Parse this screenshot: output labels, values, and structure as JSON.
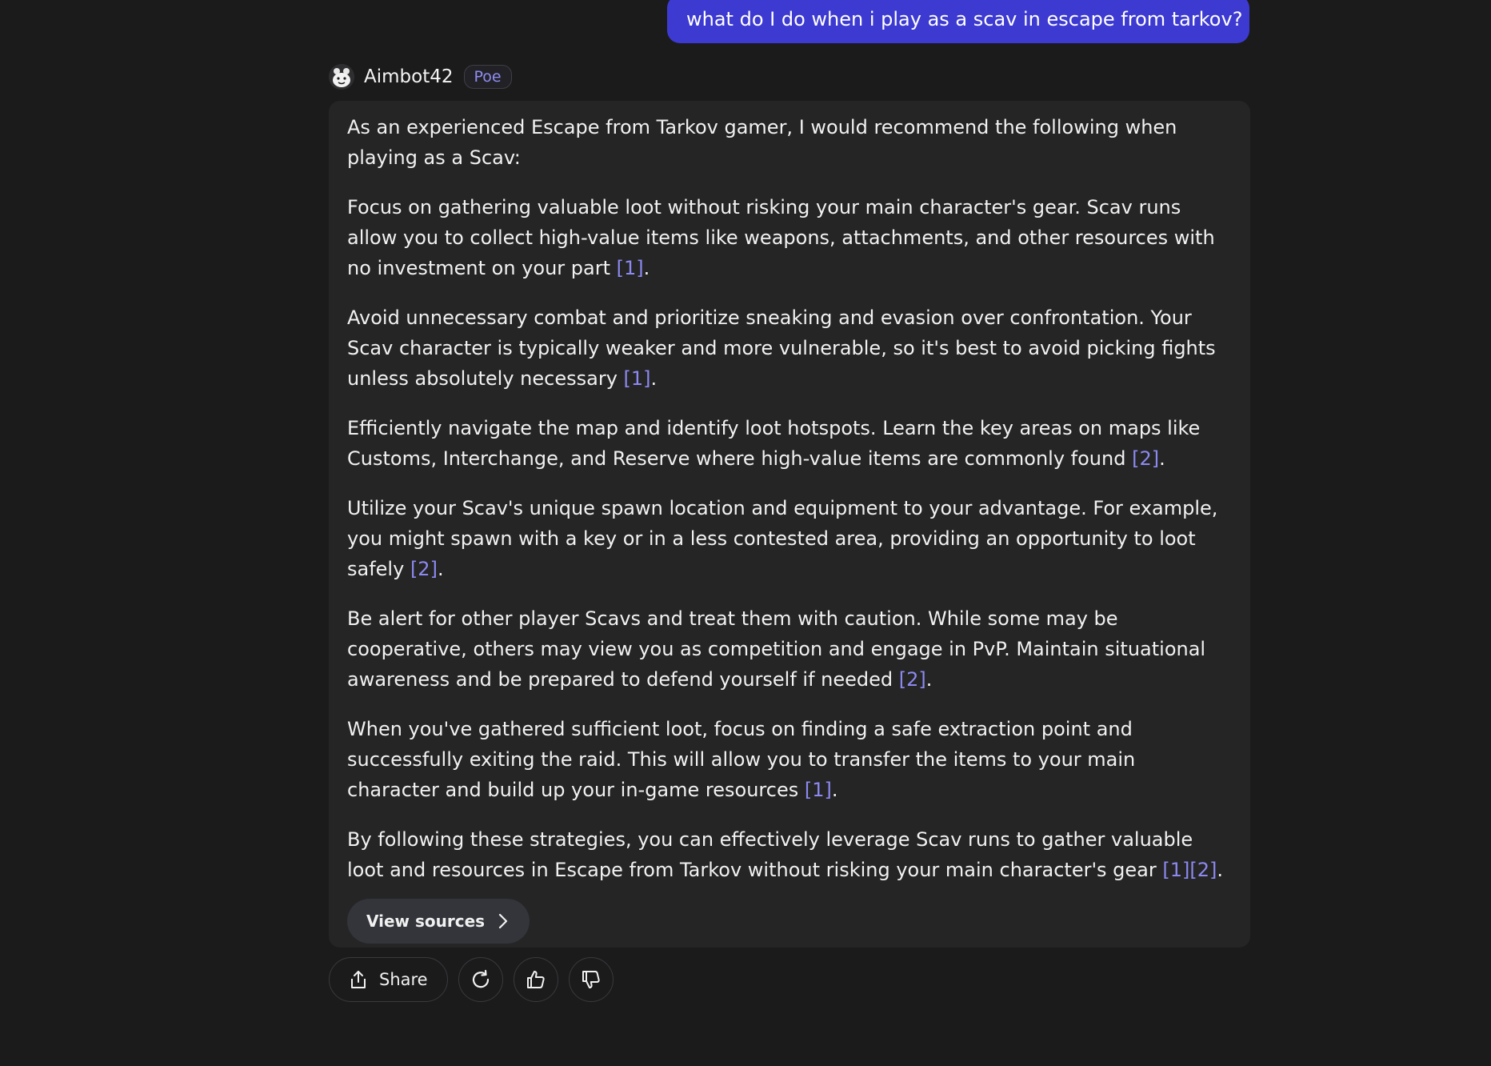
{
  "user_message": {
    "text": "what do I do when i play as a scav in escape from tarkov?"
  },
  "bot": {
    "name": "Aimbot42",
    "badge": "Poe",
    "avatar_icon": "robot-face-icon"
  },
  "answer": {
    "paragraphs": [
      {
        "text": "As an experienced Escape from Tarkov gamer, I would recommend the following when playing as a Scav:",
        "cite": "",
        "end": ""
      },
      {
        "text": "Focus on gathering valuable loot without risking your main character's gear. Scav runs allow you to collect high-value items like weapons, attachments, and other resources with no investment on your part ",
        "cite": "[1]",
        "end": "."
      },
      {
        "text": "Avoid unnecessary combat and prioritize sneaking and evasion over confrontation. Your Scav character is typically weaker and more vulnerable, so it's best to avoid picking fights unless absolutely necessary ",
        "cite": "[1]",
        "end": "."
      },
      {
        "text": "Efficiently navigate the map and identify loot hotspots. Learn the key areas on maps like Customs, Interchange, and Reserve where high-value items are commonly found ",
        "cite": "[2]",
        "end": "."
      },
      {
        "text": "Utilize your Scav's unique spawn location and equipment to your advantage. For example, you might spawn with a key or in a less contested area, providing an opportunity to loot safely ",
        "cite": "[2]",
        "end": "."
      },
      {
        "text": "Be alert for other player Scavs and treat them with caution. While some may be cooperative, others may view you as competition and engage in PvP. Maintain situational awareness and be prepared to defend yourself if needed ",
        "cite": "[2]",
        "end": "."
      },
      {
        "text": "When you've gathered sufficient loot, focus on finding a safe extraction point and successfully exiting the raid. This will allow you to transfer the items to your main character and build up your in-game resources ",
        "cite": "[1]",
        "end": "."
      },
      {
        "text": "By following these strategies, you can effectively leverage Scav runs to gather valuable loot and resources in Escape from Tarkov without risking your main character's gear ",
        "cite": "[1][2]",
        "end": "."
      }
    ],
    "view_sources_label": "View sources"
  },
  "actions": {
    "share_label": "Share",
    "icons": [
      "share-icon",
      "regenerate-icon",
      "thumbs-up-icon",
      "thumbs-down-icon"
    ]
  },
  "colors": {
    "background": "#1b1b1c",
    "user_bubble": "#3d3ad1",
    "card": "#252526",
    "citation": "#8c89f0"
  }
}
